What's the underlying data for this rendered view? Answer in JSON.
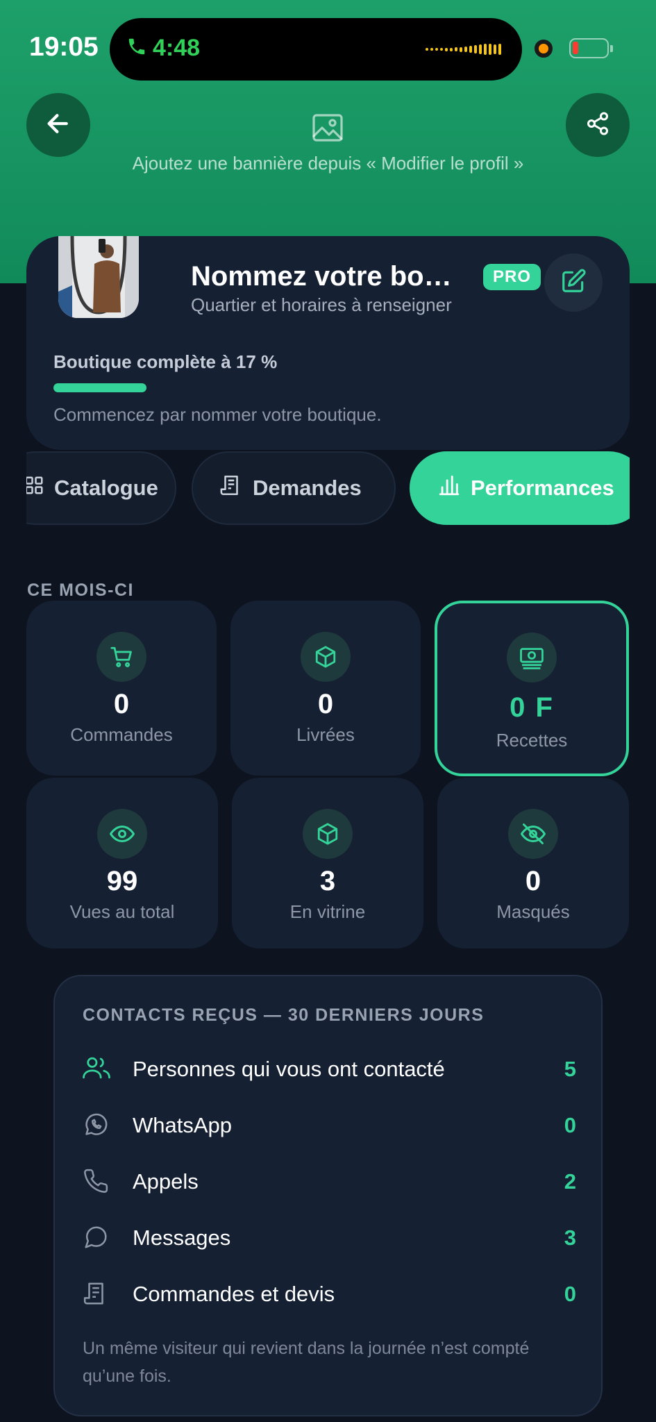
{
  "status_bar": {
    "time": "19:05",
    "call_duration": "4:48",
    "call_color": "#30d158"
  },
  "header": {
    "banner_hint": "Ajoutez une bannière depuis « Modifier le profil »",
    "back_icon": "arrow-left-icon",
    "share_icon": "share-icon",
    "banner_icon": "image-icon",
    "banner_color": "#1ea06a"
  },
  "profile": {
    "shop_name": "Nommez votre bo…",
    "badge": "PRO",
    "subtitle": "Quartier et horaires à renseigner",
    "completion_label": "Boutique complète à 17 %",
    "completion_percent": 17,
    "completion_hint": "Commencez par nommer votre boutique."
  },
  "tabs": [
    {
      "label": "Catalogue",
      "icon": "grid-icon",
      "active": false
    },
    {
      "label": "Demandes",
      "icon": "receipt-icon",
      "active": false
    },
    {
      "label": "Performances",
      "icon": "bar-chart-icon",
      "active": true
    }
  ],
  "stats": {
    "section_label": "CE MOIS-CI",
    "items": [
      {
        "value": "0",
        "label": "Commandes",
        "icon": "cart-icon"
      },
      {
        "value": "0",
        "label": "Livrées",
        "icon": "box-icon"
      },
      {
        "value": "0 F",
        "label": "Recettes",
        "icon": "banknote-icon",
        "highlighted": true
      },
      {
        "value": "99",
        "label": "Vues au total",
        "icon": "eye-icon"
      },
      {
        "value": "3",
        "label": "En vitrine",
        "icon": "box-icon"
      },
      {
        "value": "0",
        "label": "Masqués",
        "icon": "eye-off-icon"
      }
    ]
  },
  "contacts": {
    "title": "CONTACTS REÇUS — 30 DERNIERS JOURS",
    "rows": [
      {
        "label": "Personnes qui vous ont contacté",
        "count": "5",
        "icon": "users-icon"
      },
      {
        "label": "WhatsApp",
        "count": "0",
        "icon": "whatsapp-icon"
      },
      {
        "label": "Appels",
        "count": "2",
        "icon": "phone-icon"
      },
      {
        "label": "Messages",
        "count": "3",
        "icon": "message-icon"
      },
      {
        "label": "Commandes et devis",
        "count": "0",
        "icon": "receipt-icon"
      }
    ],
    "note": "Un même visiteur qui revient dans la journée n’est compté qu’une fois."
  },
  "accent_color": "#34d399"
}
